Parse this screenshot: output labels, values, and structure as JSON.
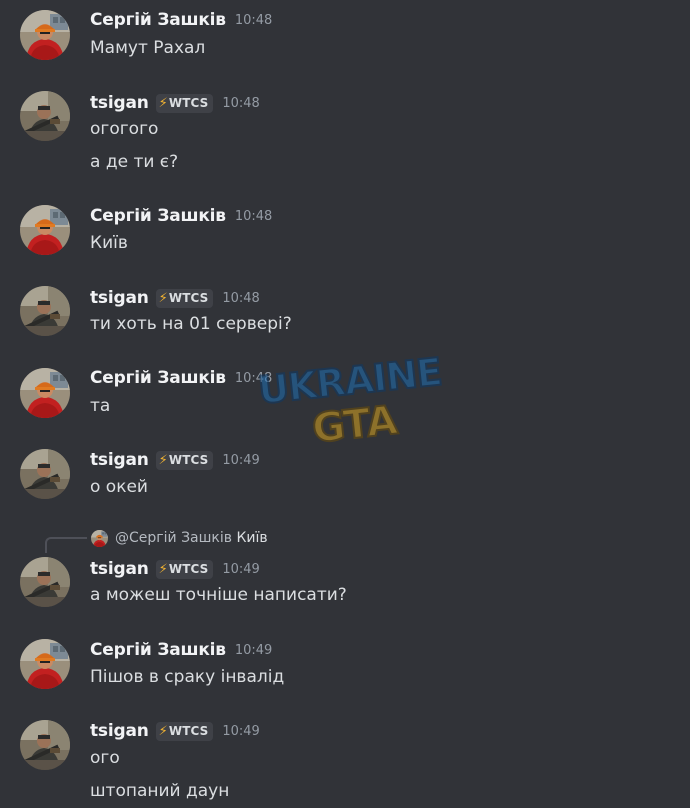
{
  "users": {
    "serhii": {
      "name": "Сергій Зашків"
    },
    "tsigan": {
      "name": "tsigan",
      "tag": "WTCS",
      "tag_icon": "lightning-bolt-icon"
    }
  },
  "messages": [
    {
      "author": "Сергій Зашків",
      "time": "10:48",
      "lines": [
        "Мамут Рахал"
      ]
    },
    {
      "author": "tsigan",
      "tag": "WTCS",
      "time": "10:48",
      "lines": [
        "огогого",
        "а де ти є?"
      ]
    },
    {
      "author": "Сергій Зашків",
      "time": "10:48",
      "lines": [
        "Київ"
      ]
    },
    {
      "author": "tsigan",
      "tag": "WTCS",
      "time": "10:48",
      "lines": [
        "ти хоть на 01 сервері?"
      ]
    },
    {
      "author": "Сергій Зашків",
      "time": "10:48",
      "lines": [
        "та"
      ]
    },
    {
      "author": "tsigan",
      "tag": "WTCS",
      "time": "10:49",
      "lines": [
        "о окей"
      ]
    },
    {
      "author": "tsigan",
      "tag": "WTCS",
      "time": "10:49",
      "lines": [
        "а можеш точніше написати?"
      ],
      "reply": {
        "mention": "@Сергій Зашків",
        "content": "Київ"
      }
    },
    {
      "author": "Сергій Зашків",
      "time": "10:49",
      "lines": [
        "Пішов в сраку інвалід"
      ]
    },
    {
      "author": "tsigan",
      "tag": "WTCS",
      "time": "10:49",
      "lines": [
        "ого",
        "штопаний даун"
      ]
    }
  ],
  "watermark": {
    "line1": "UKRAINE",
    "line2": "GTA"
  },
  "colors": {
    "background": "#313338",
    "username": "#f2f3f5",
    "text": "#dbdee1",
    "timestamp": "#949ba4",
    "tag_bg": "#3f4147",
    "bolt": "#f0b232",
    "watermark_blue": "#1e6fb5",
    "watermark_yellow": "#d9a520"
  }
}
